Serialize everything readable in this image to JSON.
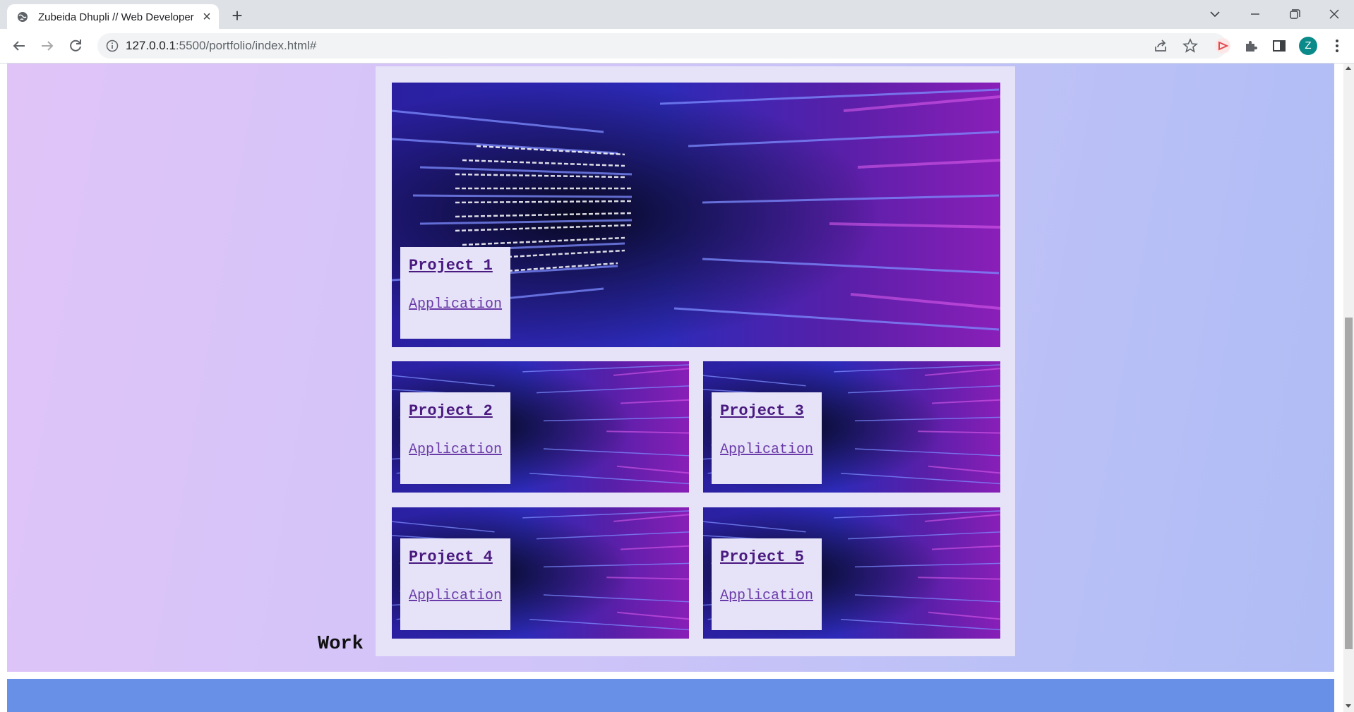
{
  "browser": {
    "tab_title": "Zubeida Dhupli // Web Developer",
    "url_host": "127.0.0.1",
    "url_rest": ":5500/portfolio/index.html#",
    "profile_initial": "Z"
  },
  "page": {
    "section_heading": "Work",
    "projects": [
      {
        "title": "Project 1",
        "subtitle": "Application"
      },
      {
        "title": "Project 2",
        "subtitle": "Application"
      },
      {
        "title": "Project 3",
        "subtitle": "Application"
      },
      {
        "title": "Project 4",
        "subtitle": "Application"
      },
      {
        "title": "Project 5",
        "subtitle": "Application"
      }
    ]
  },
  "colors": {
    "section_gradient_start": "#e0c4f8",
    "section_gradient_end": "#b0bcf5",
    "panel_bg": "#e6e3f8",
    "footer_bg": "#6890e6",
    "link_title": "#4a1a80"
  },
  "icons": [
    "globe-icon",
    "close-icon",
    "plus-icon",
    "chevron-down-icon",
    "minimize-icon",
    "restore-icon",
    "window-close-icon",
    "back-arrow-icon",
    "forward-arrow-icon",
    "reload-icon",
    "info-icon",
    "share-icon",
    "star-icon",
    "extension-screencast-icon",
    "puzzle-icon",
    "side-panel-icon",
    "kebab-menu-icon"
  ]
}
